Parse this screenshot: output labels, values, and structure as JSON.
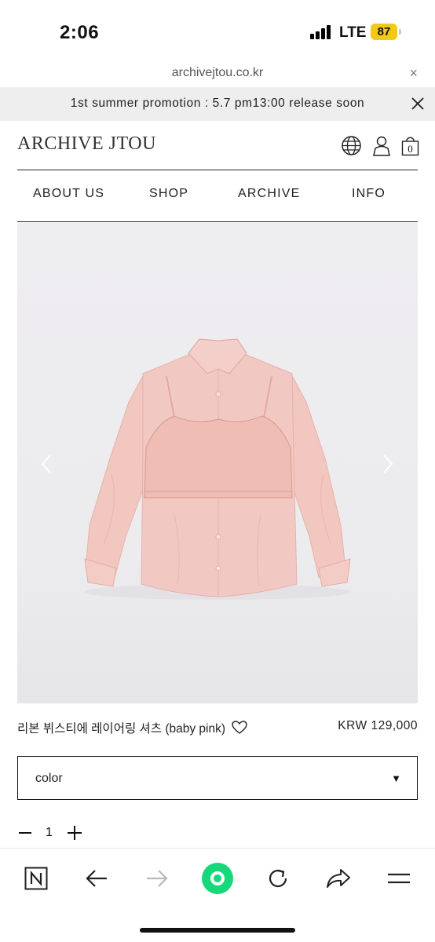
{
  "status_bar": {
    "time": "2:06",
    "network": "LTE",
    "battery": "87"
  },
  "browser": {
    "url": "archivejtou.co.kr",
    "close_icon": "×"
  },
  "promo": {
    "text": "1st summer promotion : 5.7 pm13:00 release soon"
  },
  "header": {
    "logo": "ARCHIVE JTOU",
    "cart_count": "0",
    "icons": [
      "globe-icon",
      "user-icon",
      "cart-icon"
    ]
  },
  "nav": {
    "items": [
      "ABOUT US",
      "SHOP",
      "ARCHIVE",
      "INFO"
    ]
  },
  "product": {
    "name": "리본 뷔스티에 레이어링 셔츠 (baby pink)",
    "price": "KRW 129,000",
    "image_colors": {
      "background": "#ecebee",
      "garment": "#f0c4bd"
    }
  },
  "options": {
    "color_select": "color",
    "caret": "▼"
  },
  "quantity": {
    "value": "1"
  },
  "toolbar": {
    "icons": [
      "naver-icon",
      "back-arrow-icon",
      "forward-arrow-icon",
      "green-dot-icon",
      "reload-icon",
      "share-icon",
      "menu-icon"
    ],
    "accent": "#16d87a"
  }
}
